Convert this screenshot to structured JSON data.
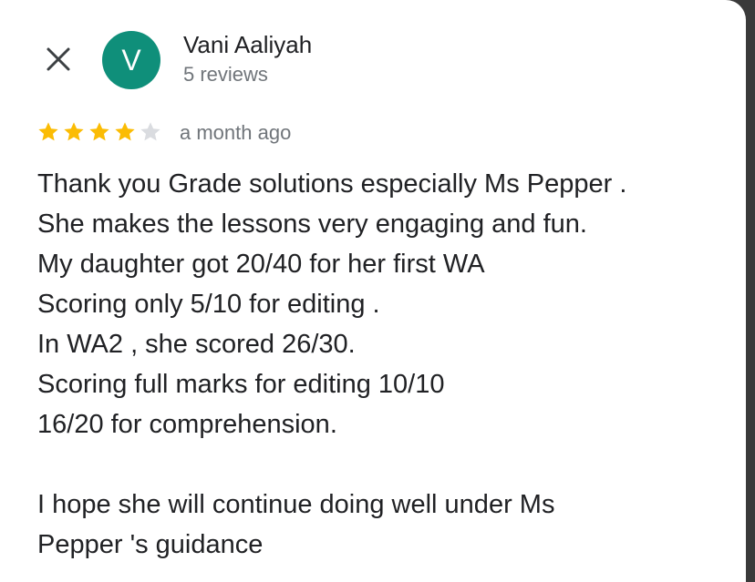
{
  "review": {
    "author": {
      "name": "Vani Aaliyah",
      "initial": "V",
      "reviews": "5 reviews",
      "avatar_color": "#0f8f7a"
    },
    "rating": {
      "value": 4,
      "max": 5,
      "filled_color": "#fbbc04",
      "empty_color": "#dadce0"
    },
    "date": "a month ago",
    "text_lines": [
      "Thank you Grade solutions especially Ms Pepper .",
      "She makes the lessons very engaging and fun.",
      "My daughter got 20/40 for her first WA",
      "Scoring only 5/10 for editing .",
      "In WA2 , she scored 26/30.",
      "Scoring full marks for editing 10/10",
      "16/20 for comprehension.",
      "",
      "I hope she will continue doing well under Ms",
      "Pepper 's guidance"
    ]
  },
  "icons": {
    "close": "close-icon",
    "star": "star-icon"
  }
}
